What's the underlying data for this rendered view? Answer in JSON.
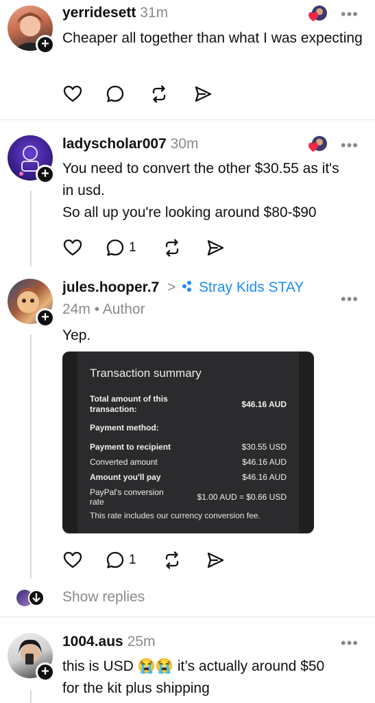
{
  "posts": [
    {
      "username": "yerridesett",
      "time": "31m",
      "text": "Cheaper all together than what I was expecting",
      "more": "•••"
    },
    {
      "username": "ladyscholar007",
      "time": "30m",
      "text_lines": [
        "You need to convert the other $30.55 as it's",
        "in usd.",
        "So all up you're looking around $80-$90"
      ],
      "reply_count": "1",
      "more": "•••"
    },
    {
      "username": "jules.hooper.7",
      "separator": ">",
      "community": "Stray Kids STAY",
      "time": "24m",
      "author_tag": "• Author",
      "text": "Yep.",
      "reply_count": "1",
      "more": "•••",
      "show_replies": "Show replies"
    },
    {
      "username": "1004.aus",
      "time": "25m",
      "text_lines": [
        "this is USD 😭😭 it’s actually around $50",
        "for the kit plus shipping"
      ],
      "more": "•••"
    }
  ],
  "transaction": {
    "title": "Transaction summary",
    "total_label_1": "Total amount of this",
    "total_label_2": "transaction:",
    "total_value": "$46.16 AUD",
    "payment_method": "Payment method:",
    "rows": [
      {
        "label": "Payment to recipient",
        "value": "$30.55 USD",
        "bold": true
      },
      {
        "label": "Converted amount",
        "value": "$46.16 AUD",
        "bold": false
      },
      {
        "label": "Amount you'll pay",
        "value": "$46.16 AUD",
        "bold": true
      }
    ],
    "rate_label_1": "PayPal's conversion",
    "rate_label_2": "rate",
    "rate_value": "$1.00 AUD = $0.66 USD",
    "note": "This rate includes our currency conversion fee."
  },
  "colors": {
    "community": "#1a8cff",
    "muted": "#8a8a8a",
    "card_bg": "#1f1f1f"
  },
  "icons": [
    "heart-icon",
    "comment-icon",
    "repost-icon",
    "share-icon",
    "more-icon",
    "plus-icon",
    "down-arrow-icon"
  ]
}
